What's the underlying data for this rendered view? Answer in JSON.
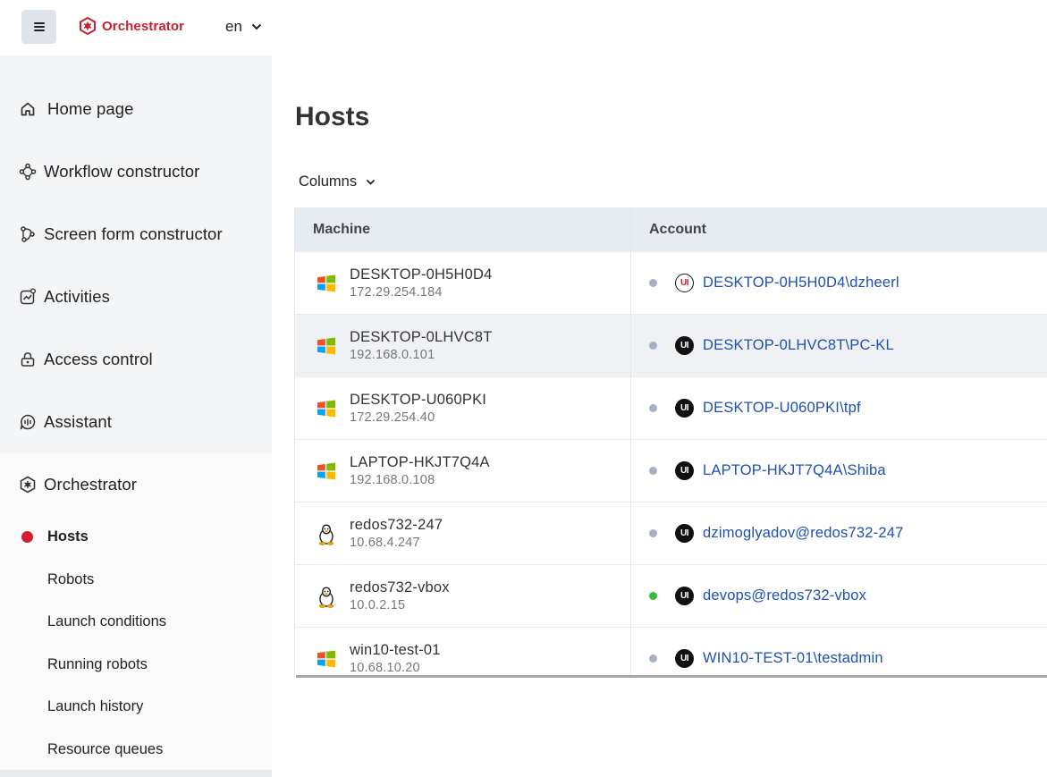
{
  "header": {
    "brand": "Orchestrator",
    "language": "en"
  },
  "sidebar": {
    "items": [
      {
        "label": "Home page",
        "icon": "home-icon"
      },
      {
        "label": "Workflow constructor",
        "icon": "workflow-icon"
      },
      {
        "label": "Screen form constructor",
        "icon": "screen-form-icon"
      },
      {
        "label": "Activities",
        "icon": "activities-icon"
      },
      {
        "label": "Access control",
        "icon": "access-control-icon"
      },
      {
        "label": "Assistant",
        "icon": "assistant-icon"
      },
      {
        "label": "Orchestrator",
        "icon": "orchestrator-icon"
      }
    ],
    "orchestrator_subitems": [
      {
        "label": "Hosts",
        "active": true
      },
      {
        "label": "Robots"
      },
      {
        "label": "Launch conditions"
      },
      {
        "label": "Running robots"
      },
      {
        "label": "Launch history"
      },
      {
        "label": "Resource queues"
      }
    ]
  },
  "main": {
    "title": "Hosts",
    "columns_button": "Columns",
    "table": {
      "headers": [
        "Machine",
        "Account"
      ],
      "rows": [
        {
          "machine": "DESKTOP-0H5H0D4",
          "ip": "172.29.254.184",
          "os": "windows",
          "status": "offline",
          "account": "DESKTOP-0H5H0D4\\dzheerl",
          "badge": "special"
        },
        {
          "machine": "DESKTOP-0LHVC8T",
          "ip": "192.168.0.101",
          "os": "windows",
          "status": "offline",
          "account": "DESKTOP-0LHVC8T\\PC-KL",
          "badge": "normal"
        },
        {
          "machine": "DESKTOP-U060PKI",
          "ip": "172.29.254.40",
          "os": "windows",
          "status": "offline",
          "account": "DESKTOP-U060PKI\\tpf",
          "badge": "normal"
        },
        {
          "machine": "LAPTOP-HKJT7Q4A",
          "ip": "192.168.0.108",
          "os": "windows",
          "status": "offline",
          "account": "LAPTOP-HKJT7Q4A\\Shiba",
          "badge": "normal"
        },
        {
          "machine": "redos732-247",
          "ip": "10.68.4.247",
          "os": "linux",
          "status": "offline",
          "account": "dzimoglyadov@redos732-247",
          "badge": "normal"
        },
        {
          "machine": "redos732-vbox",
          "ip": "10.0.2.15",
          "os": "linux",
          "status": "online",
          "account": "devops@redos732-vbox",
          "badge": "normal"
        },
        {
          "machine": "win10-test-01",
          "ip": "10.68.10.20",
          "os": "windows",
          "status": "offline",
          "account": "WIN10-TEST-01\\testadmin",
          "badge": "normal"
        }
      ],
      "badge_text": "UI"
    }
  },
  "colors": {
    "brand": "#c8202f",
    "link": "#1d4fb5",
    "online": "#36bb36",
    "offline": "#a7b0c2",
    "active_dot": "#d0202f"
  }
}
